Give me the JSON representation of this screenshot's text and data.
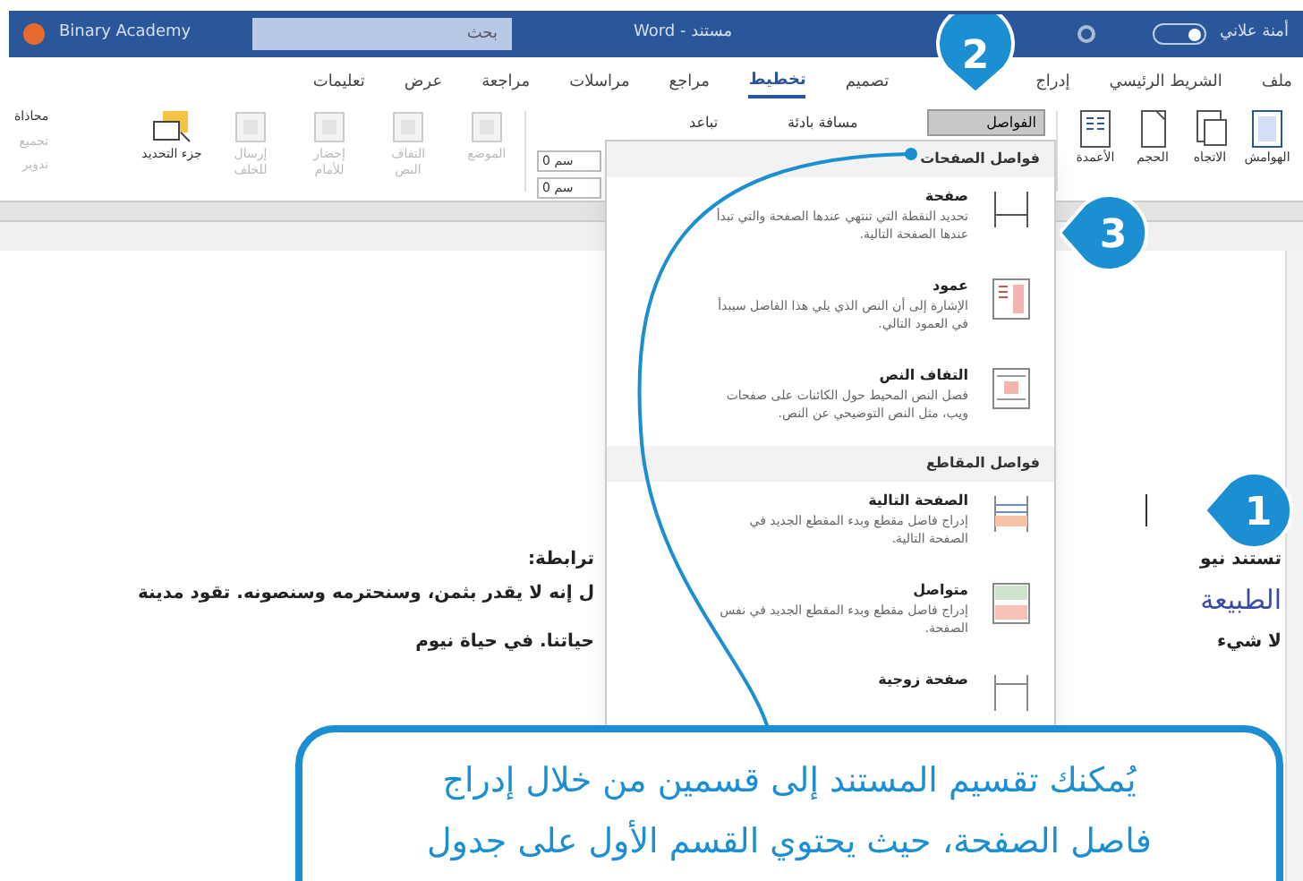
{
  "title_bar": {
    "account": "Binary Academy",
    "toggle": {
      "on": true
    },
    "search": {
      "placeholder": "بحث"
    },
    "title": "Word - مستند",
    "user": "أمنة علاني"
  },
  "tabs": [
    {
      "label": "ملف",
      "selected": false
    },
    {
      "label": "الشريط الرئيسي",
      "selected": false
    },
    {
      "label": "إدراج",
      "selected": false
    },
    {
      "label": "تصميم",
      "selected": false
    },
    {
      "label": "تخطيط",
      "selected": true
    },
    {
      "label": "مراجع",
      "selected": false
    },
    {
      "label": "مراسلات",
      "selected": false
    },
    {
      "label": "مراجعة",
      "selected": false
    },
    {
      "label": "عرض",
      "selected": false
    },
    {
      "label": "تعليمات",
      "selected": false
    }
  ],
  "ribbon": {
    "page_setup": [
      {
        "label": "الهوامش",
        "kind": "margins"
      },
      {
        "label": "الاتجاه",
        "kind": "orientation"
      },
      {
        "label": "الحجم",
        "kind": "size"
      },
      {
        "label": "الأعمدة",
        "kind": "columns"
      }
    ],
    "breaks_button": {
      "label": "الفواصل",
      "selected": true
    },
    "paragraph": {
      "indent": "مسافة بادئة",
      "spacing": "تباعد",
      "fields": [
        "0 سم",
        "0 سم"
      ]
    },
    "arrange": [
      {
        "label": "الموضع",
        "disabled": true
      },
      {
        "label": "التفاف النص",
        "disabled": true
      },
      {
        "label": "إحضار للأمام",
        "disabled": true
      },
      {
        "label": "إرسال للخلف",
        "disabled": true
      },
      {
        "label": "جزء التحديد",
        "disabled": false
      }
    ],
    "arrange_small": [
      {
        "label": "محاذاة",
        "disabled": false
      },
      {
        "label": "تجميع",
        "disabled": true
      },
      {
        "label": "تدوير",
        "disabled": true
      }
    ]
  },
  "breaks_menu": [
    {
      "heading": "فواصل الصفحات",
      "items": [
        {
          "kind": "page",
          "title": "صفحة",
          "description": "تحديد النقطة التي تنتهي عندها الصفحة والتي تبدأ عندها الصفحة التالية."
        },
        {
          "kind": "column",
          "title": "عمود",
          "description": "الإشارة إلى أن النص الذي يلي هذا الفاصل سيبدأ في العمود التالي."
        },
        {
          "kind": "wrapping",
          "title": "التفاف النص",
          "description": "فصل النص المحيط حول الكائنات على صفحات ويب، مثل النص التوضيحي عن النص."
        }
      ]
    },
    {
      "heading": "فواصل المقاطع",
      "items": [
        {
          "kind": "next_page",
          "title": "الصفحة التالية",
          "description": "إدراج فاصل مقطع وبدء المقطع الجديد في الصفحة التالية."
        },
        {
          "kind": "continuous",
          "title": "متواصل",
          "description": "إدراج فاصل مقطع وبدء المقطع الجديد في نفس الصفحة."
        },
        {
          "kind": "even_page",
          "title": "صفحة زوجية"
        }
      ]
    }
  ],
  "document": {
    "right": [
      {
        "text": "تستند نيو",
        "kind": "body"
      },
      {
        "text": "الطبيعة",
        "kind": "heading"
      },
      {
        "text": "لا شيء",
        "kind": "body"
      }
    ],
    "left": [
      {
        "text": "ترابطة:",
        "kind": "body"
      },
      {
        "text": "ل إنه لا يقدر بثمن، وسنحترمه وسنصونه. تقود مدينة",
        "kind": "body"
      },
      {
        "text": "حياتنا. في حياة نيوم",
        "kind": "body"
      }
    ]
  },
  "markers": [
    {
      "number": "2"
    },
    {
      "number": "3"
    },
    {
      "number": "1"
    }
  ],
  "note": {
    "lines": [
      "يُمكنك تقسيم المستند إلى قسمين من خلال إدراج",
      "فاصل الصفحة، حيث يحتوي القسم الأول على جدول"
    ]
  }
}
